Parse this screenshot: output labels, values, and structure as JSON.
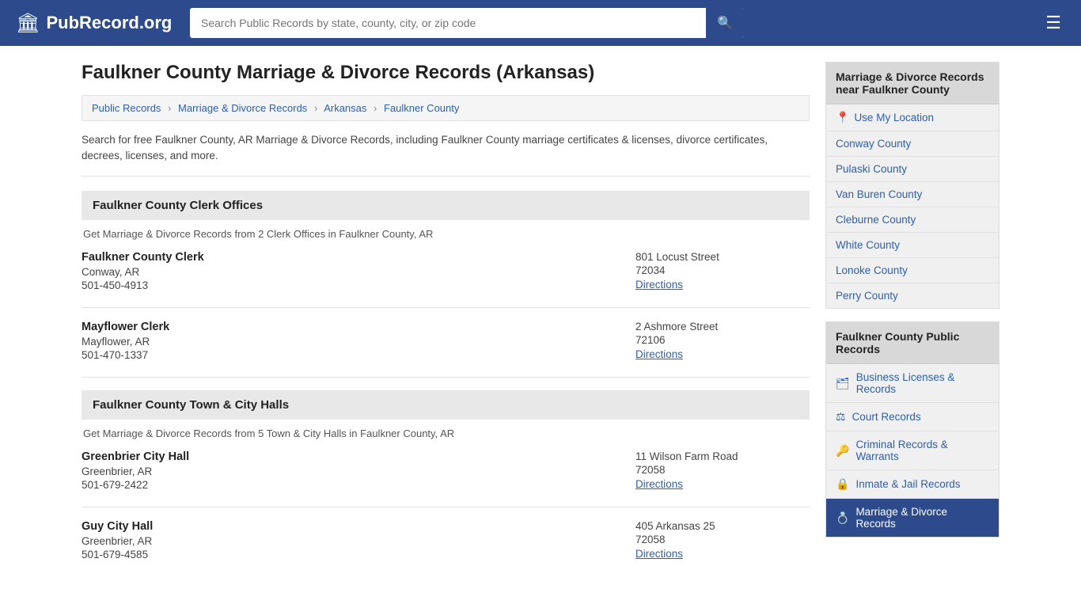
{
  "header": {
    "logo_icon": "🏛",
    "logo_text": "PubRecord.org",
    "search_placeholder": "Search Public Records by state, county, city, or zip code",
    "search_button_label": "🔍",
    "menu_button_label": "☰"
  },
  "page": {
    "title": "Faulkner County Marriage & Divorce Records (Arkansas)",
    "description": "Search for free Faulkner County, AR Marriage & Divorce Records, including Faulkner County marriage certificates & licenses, divorce certificates, decrees, licenses, and more."
  },
  "breadcrumb": {
    "items": [
      {
        "label": "Public Records",
        "href": "#"
      },
      {
        "label": "Marriage & Divorce Records",
        "href": "#"
      },
      {
        "label": "Arkansas",
        "href": "#"
      },
      {
        "label": "Faulkner County",
        "href": "#"
      }
    ]
  },
  "clerk_offices": {
    "heading": "Faulkner County Clerk Offices",
    "description": "Get Marriage & Divorce Records from 2 Clerk Offices in Faulkner County, AR",
    "offices": [
      {
        "name": "Faulkner County Clerk",
        "city": "Conway, AR",
        "phone": "501-450-4913",
        "street": "801 Locust Street",
        "zip": "72034",
        "directions_label": "Directions"
      },
      {
        "name": "Mayflower Clerk",
        "city": "Mayflower, AR",
        "phone": "501-470-1337",
        "street": "2 Ashmore Street",
        "zip": "72106",
        "directions_label": "Directions"
      }
    ]
  },
  "city_halls": {
    "heading": "Faulkner County Town & City Halls",
    "description": "Get Marriage & Divorce Records from 5 Town & City Halls in Faulkner County, AR",
    "offices": [
      {
        "name": "Greenbrier City Hall",
        "city": "Greenbrier, AR",
        "phone": "501-679-2422",
        "street": "11 Wilson Farm Road",
        "zip": "72058",
        "directions_label": "Directions"
      },
      {
        "name": "Guy City Hall",
        "city": "Greenbrier, AR",
        "phone": "501-679-4585",
        "street": "405 Arkansas 25",
        "zip": "72058",
        "directions_label": "Directions"
      }
    ]
  },
  "sidebar": {
    "nearby": {
      "title": "Marriage & Divorce Records near Faulkner County",
      "use_my_location": "Use My Location",
      "counties": [
        "Conway County",
        "Pulaski County",
        "Van Buren County",
        "Cleburne County",
        "White County",
        "Lonoke County",
        "Perry County"
      ]
    },
    "public_records": {
      "title": "Faulkner County Public Records",
      "items": [
        {
          "icon": "🗂",
          "label": "Business Licenses & Records",
          "active": false
        },
        {
          "icon": "⚖",
          "label": "Court Records",
          "active": false
        },
        {
          "icon": "🔑",
          "label": "Criminal Records & Warrants",
          "active": false
        },
        {
          "icon": "🔒",
          "label": "Inmate & Jail Records",
          "active": false
        },
        {
          "icon": "💍",
          "label": "Marriage & Divorce Records",
          "active": true
        }
      ]
    }
  }
}
